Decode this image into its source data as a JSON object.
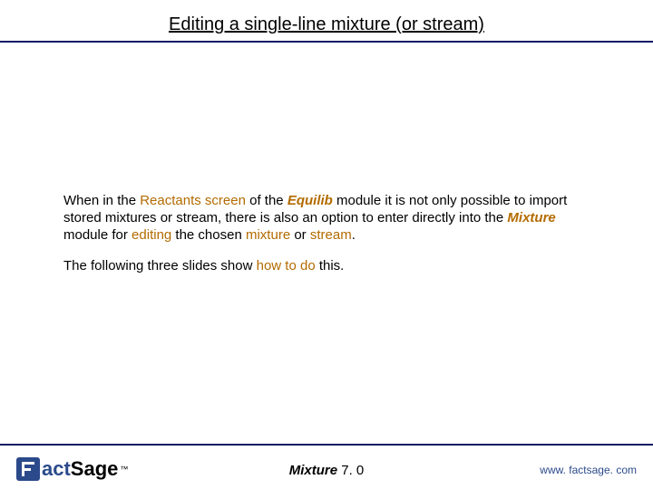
{
  "header": {
    "title": "Editing a single-line mixture (or stream)"
  },
  "para1": {
    "t1": "When in the ",
    "k1": "Reactants screen",
    "t2": " of the ",
    "k2": "Equilib",
    "t3": " module it is not only possible to import stored mixtures or stream, there is also an option to enter directly into the ",
    "k3": "Mixture",
    "t4": " module for ",
    "k4": "editing",
    "t5": " the chosen ",
    "k5": "mixture",
    "t6": " or ",
    "k6": "stream",
    "t7": "."
  },
  "para2": {
    "t1": "The following three slides show ",
    "k1": "how to do",
    "t2": " this."
  },
  "footer": {
    "logo_text1": "act",
    "logo_text2": "Sage",
    "tm": "™",
    "center_name": "Mixture",
    "center_ver": "  7. 0",
    "url": "www. factsage. com"
  }
}
